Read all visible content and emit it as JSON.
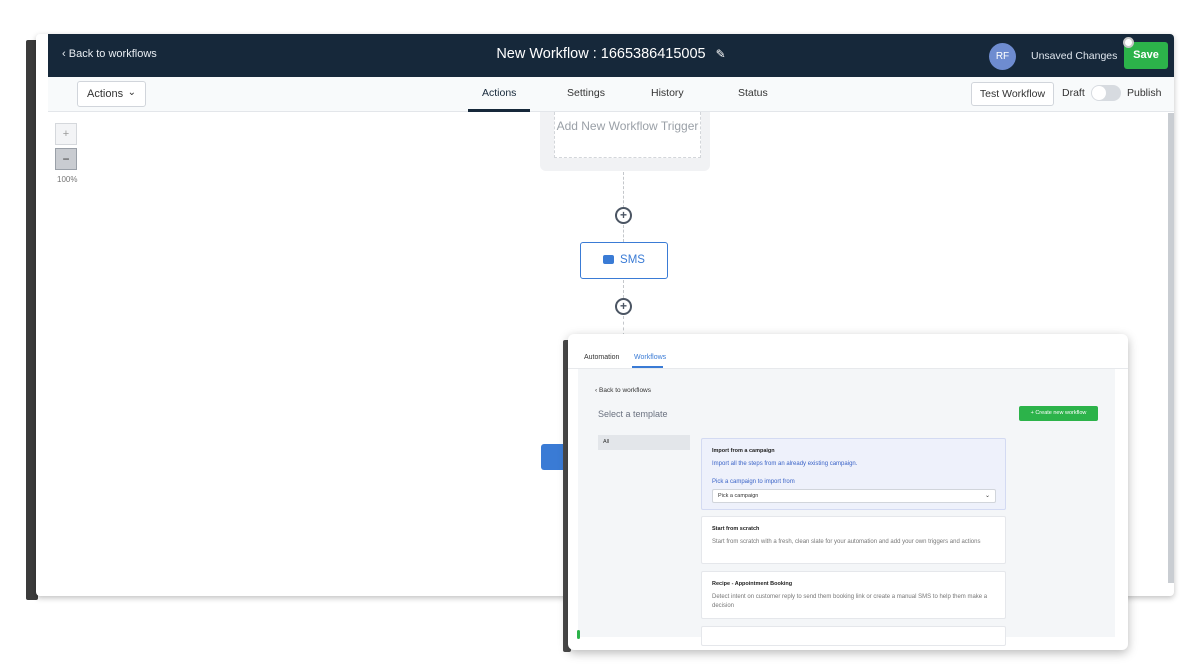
{
  "colors": {
    "topbar": "#16283a",
    "accent_green": "#2cb34a",
    "accent_blue": "#3a7bd5",
    "avatar": "#6e8cd0"
  },
  "topbar": {
    "back_label": "Back to workflows",
    "title": "New Workflow : 1665386415005",
    "edit_icon": "pencil-icon",
    "avatar_initials": "RF",
    "unsaved": "Unsaved Changes",
    "save_label": "Save"
  },
  "subbar": {
    "actions_label": "Actions",
    "tabs": [
      {
        "label": "Actions",
        "active": true
      },
      {
        "label": "Settings",
        "active": false
      },
      {
        "label": "History",
        "active": false
      },
      {
        "label": "Status",
        "active": false
      }
    ],
    "test_workflow_label": "Test Workflow",
    "draft_label": "Draft",
    "publish_label": "Publish",
    "published": false
  },
  "canvas": {
    "zoom_in": "+",
    "zoom_out": "−",
    "zoom_level": "100%",
    "trigger_label": "Add New Workflow Trigger",
    "sms_label": "SMS"
  },
  "overlay": {
    "tabs": [
      {
        "label": "Automation",
        "active": false
      },
      {
        "label": "Workflows",
        "active": true
      }
    ],
    "back_label": "Back to workflows",
    "select_template": "Select a template",
    "create_button": "+ Create new workflow",
    "categories": [
      "All"
    ],
    "cards": [
      {
        "title": "Import from a campaign",
        "description": "Import all the steps from an already existing campaign.",
        "pick_label": "Pick a campaign to import from",
        "dropdown_value": "Pick a campaign"
      },
      {
        "title": "Start from scratch",
        "description": "Start from scratch with a fresh, clean slate for your automation and add your own triggers and actions"
      },
      {
        "title": "Recipe - Appointment Booking",
        "description": "Detect intent on customer reply to send them booking link or create a manual SMS to help them make a decision"
      }
    ]
  }
}
